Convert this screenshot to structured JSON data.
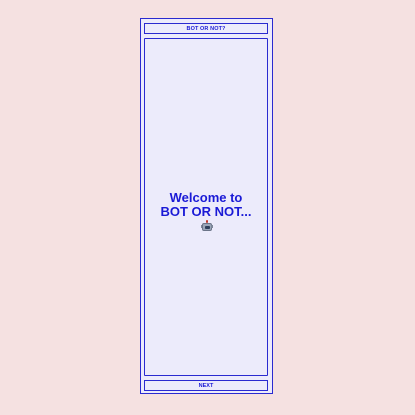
{
  "header": {
    "title": "BOT OR NOT?"
  },
  "main": {
    "welcome_text": "Welcome to BOT OR NOT...",
    "welcome_icon": "robot-icon"
  },
  "footer": {
    "next_label": "NEXT"
  },
  "colors": {
    "background": "#f5e1e1",
    "panel": "#ecebfb",
    "accent": "#1a1ad6"
  }
}
